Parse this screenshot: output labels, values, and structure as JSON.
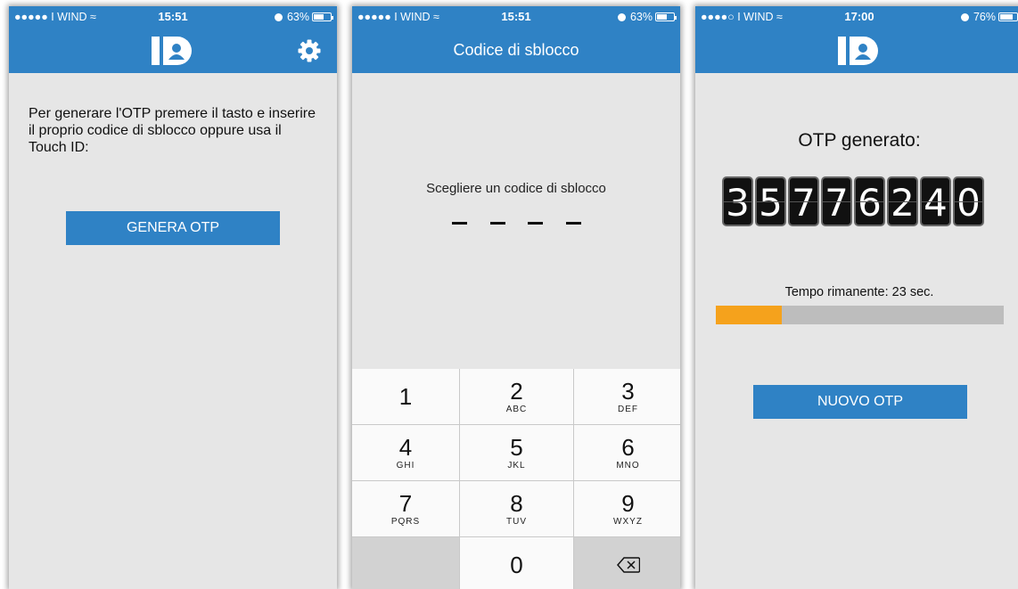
{
  "screens": [
    {
      "status": {
        "carrier": "●●●●● I WIND ≈",
        "time": "15:51",
        "battery": "63%",
        "battery_level": 0.63
      },
      "header": {
        "logo_icon": "id-badge-icon",
        "settings_icon": "gear-icon"
      },
      "intro_text": "Per generare l'OTP premere il tasto e inserire il proprio codice di sblocco oppure usa il Touch ID:",
      "button_label": "GENERA OTP"
    },
    {
      "status": {
        "carrier": "●●●●● I WIND ≈",
        "time": "15:51",
        "battery": "63%",
        "battery_level": 0.63
      },
      "header": {
        "title": "Codice di sblocco"
      },
      "prompt": "Scegliere un codice di sblocco",
      "pin_length": 4,
      "keypad": [
        {
          "num": "1",
          "letters": ""
        },
        {
          "num": "2",
          "letters": "ABC"
        },
        {
          "num": "3",
          "letters": "DEF"
        },
        {
          "num": "4",
          "letters": "GHI"
        },
        {
          "num": "5",
          "letters": "JKL"
        },
        {
          "num": "6",
          "letters": "MNO"
        },
        {
          "num": "7",
          "letters": "PQRS"
        },
        {
          "num": "8",
          "letters": "TUV"
        },
        {
          "num": "9",
          "letters": "WXYZ"
        },
        {
          "num": "",
          "letters": ""
        },
        {
          "num": "0",
          "letters": ""
        },
        {
          "num": "⌫",
          "letters": ""
        }
      ]
    },
    {
      "status": {
        "carrier": "●●●●○ I WIND ≈",
        "time": "17:00",
        "battery": "76%",
        "battery_level": 0.76
      },
      "header": {
        "logo_icon": "id-badge-icon"
      },
      "otp_title": "OTP generato:",
      "otp_digits": [
        "3",
        "5",
        "7",
        "7",
        "6",
        "2",
        "4",
        "0"
      ],
      "remaining_text": "Tempo rimanente: 23 sec.",
      "remaining_fraction": 0.23,
      "button_label": "NUOVO OTP"
    }
  ],
  "colors": {
    "primary": "#2f82c5",
    "progress": "#f5a21c",
    "track": "#bdbdbd",
    "background": "#e6e6e6"
  }
}
